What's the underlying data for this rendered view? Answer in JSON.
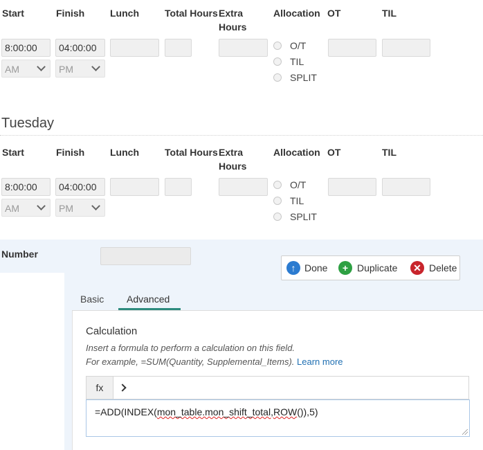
{
  "columns": {
    "start": "Start",
    "finish": "Finish",
    "lunch": "Lunch",
    "total_hours": "Total Hours",
    "extra_hours_line1": "Extra",
    "extra_hours_line2": "Hours",
    "allocation": "Allocation",
    "ot": "OT",
    "til": "TIL"
  },
  "monday": {
    "start_value": "8:00:00",
    "finish_value": "04:00:00",
    "start_ampm": "AM",
    "finish_ampm": "PM",
    "allocation_options": [
      "O/T",
      "TIL",
      "SPLIT"
    ]
  },
  "tuesday": {
    "title": "Tuesday",
    "start_value": "8:00:00",
    "finish_value": "04:00:00",
    "start_ampm": "AM",
    "finish_ampm": "PM",
    "allocation_options": [
      "O/T",
      "TIL",
      "SPLIT"
    ]
  },
  "number_field": {
    "label": "Number"
  },
  "toolbar": {
    "done_label": "Done",
    "duplicate_label": "Duplicate",
    "delete_label": "Delete",
    "done_icon_color": "#2b7bd0",
    "duplicate_icon_color": "#2ea043",
    "delete_icon_color": "#c8252c"
  },
  "tabs": {
    "basic": "Basic",
    "advanced": "Advanced",
    "active": "Advanced",
    "accent_color": "#2e8b7e"
  },
  "calculation": {
    "title": "Calculation",
    "help_line1": "Insert a formula to perform a calculation on this field.",
    "help_line2_prefix": "For example, =SUM(Quantity, Supplemental_Items).",
    "learn_more": "Learn more",
    "fx_label": "fx",
    "formula_prefix": "=ADD(INDEX(",
    "formula_misspelled": "mon_table.mon_shift_total,ROW",
    "formula_suffix": "()),5)"
  }
}
